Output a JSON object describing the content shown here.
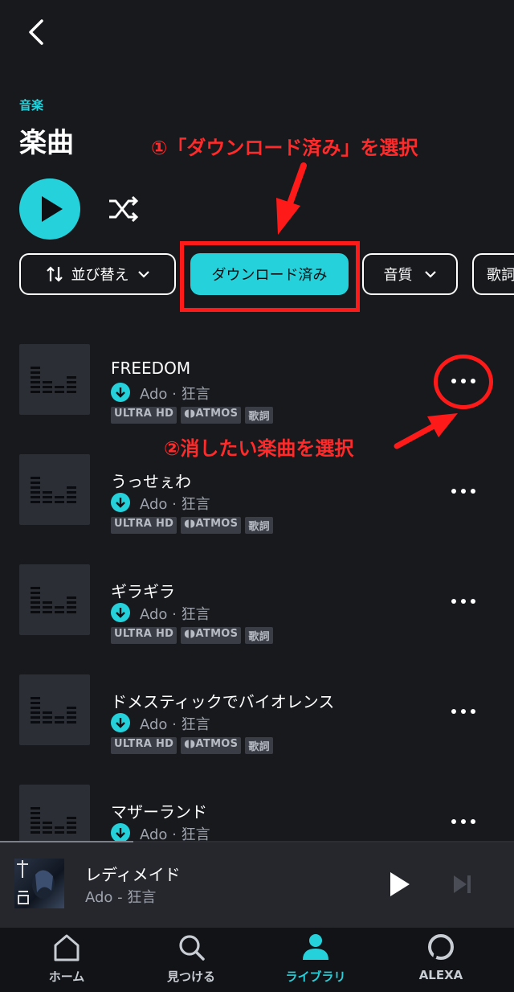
{
  "header": {
    "back_icon": "chevron-left-icon",
    "category": "音楽",
    "title": "楽曲",
    "play_icon": "play-icon",
    "shuffle_icon": "shuffle-icon"
  },
  "filters": {
    "sort_label": "並び替え",
    "downloaded_label": "ダウンロード済み",
    "quality_label": "音質",
    "lyrics_label": "歌詞"
  },
  "tracks": [
    {
      "title": "FREEDOM",
      "meta": "Ado · 狂言",
      "badges": [
        "ULTRA HD",
        "ATMOS",
        "歌詞"
      ]
    },
    {
      "title": "うっせぇわ",
      "meta": "Ado · 狂言",
      "badges": [
        "ULTRA HD",
        "ATMOS",
        "歌詞"
      ]
    },
    {
      "title": "ギラギラ",
      "meta": "Ado · 狂言",
      "badges": [
        "ULTRA HD",
        "ATMOS",
        "歌詞"
      ]
    },
    {
      "title": "ドメスティックでバイオレンス",
      "meta": "Ado · 狂言",
      "badges": [
        "ULTRA HD",
        "ATMOS",
        "歌詞"
      ]
    },
    {
      "title": "マザーランド",
      "meta": "Ado · 狂言",
      "badges": []
    }
  ],
  "now_playing": {
    "title": "レディメイド",
    "artist": "Ado - 狂言",
    "progress": 0.26
  },
  "nav": [
    {
      "label": "ホーム",
      "icon": "home-icon",
      "active": false
    },
    {
      "label": "見つける",
      "icon": "search-icon",
      "active": false
    },
    {
      "label": "ライブラリ",
      "icon": "library-person-icon",
      "active": true
    },
    {
      "label": "ALEXA",
      "icon": "alexa-icon",
      "active": false
    }
  ],
  "annotations": {
    "step1": "①「ダウンロード済み」を選択",
    "step2": "②消したい楽曲を選択"
  },
  "colors": {
    "accent": "#25d1da",
    "background": "#17191d",
    "annotation": "#ff1a1a"
  }
}
